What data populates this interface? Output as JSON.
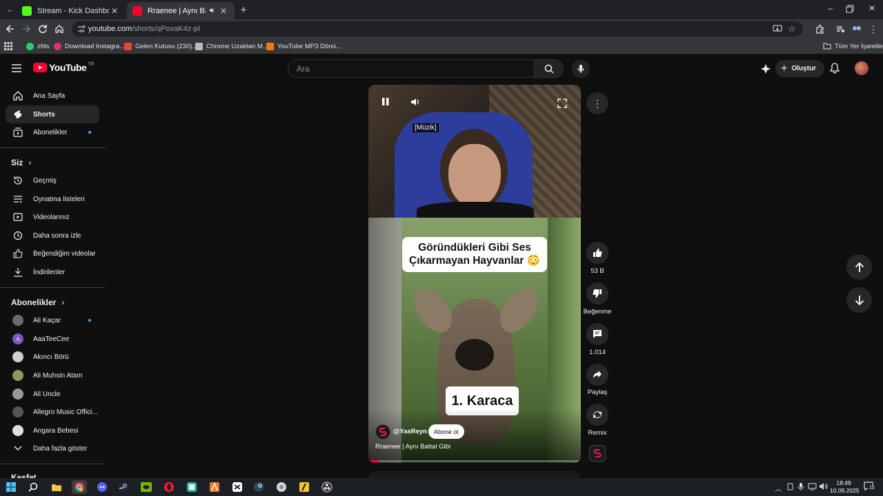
{
  "browser": {
    "tabs": [
      {
        "title": "Stream - Kick Dashboard",
        "favicon_color": "#53fc18"
      },
      {
        "title": "Rraenee | Aynı Battal Gibi -",
        "favicon_color": "#ff0033"
      }
    ],
    "url_host": "youtube.com",
    "url_path": "/shorts/qPoxaK4z-pI",
    "bookmarks": [
      "zfds",
      "Download Instagra...",
      "Gelen Kutusu (230)...",
      "Chrome Uzaktan M...",
      "YouTube MP3 Dönü..."
    ],
    "all_bookmarks": "Tüm Yer İşaretleri"
  },
  "youtube": {
    "logo_text": "YouTube",
    "region": "TR",
    "search_placeholder": "Ara",
    "create_label": "Oluştur",
    "accent": "#ff0033",
    "sidebar": {
      "main": [
        {
          "label": "Ana Sayfa",
          "icon": "home-icon"
        },
        {
          "label": "Shorts",
          "icon": "shorts-icon"
        },
        {
          "label": "Abonelikler",
          "icon": "subscriptions-icon"
        }
      ],
      "you_heading": "Siz",
      "you": [
        {
          "label": "Geçmiş",
          "icon": "history-icon"
        },
        {
          "label": "Oynatma listeleri",
          "icon": "playlists-icon"
        },
        {
          "label": "Videolarınız",
          "icon": "your-videos-icon"
        },
        {
          "label": "Daha sonra izle",
          "icon": "watch-later-icon"
        },
        {
          "label": "Beğendiğim videolar",
          "icon": "liked-icon"
        },
        {
          "label": "İndirilenler",
          "icon": "download-icon"
        }
      ],
      "subs_heading": "Abonelikler",
      "subs": [
        {
          "label": "Ali Kaçar",
          "color": "#6b6b6b"
        },
        {
          "label": "AaaTeeCee",
          "color": "#7e57c2"
        },
        {
          "label": "Akıncı Börü",
          "color": "#d0d0d0"
        },
        {
          "label": "Ali Muhsin Atam",
          "color": "#8a9a5b"
        },
        {
          "label": "Ali Uncle",
          "color": "#999999"
        },
        {
          "label": "Allegro Music Offici...",
          "color": "#555555"
        },
        {
          "label": "Angara Bebesi",
          "color": "#e0e0e0"
        }
      ],
      "show_more": "Daha fazla göster",
      "explore_heading": "Keşfet"
    },
    "short": {
      "caption_tag": "[Müzik]",
      "overlay_title_line1": "Göründükleri Gibi Ses",
      "overlay_title_line2": "Çıkarmayan Hayvanlar 😳",
      "overlay_label": "1. Karaca",
      "channel": "@YasReyn",
      "subscribe_label": "Abone ol",
      "video_title": "Rraenee | Aynı Battal Gibi",
      "progress": 0.05
    },
    "actions": {
      "likes": "53 B",
      "dislike_label": "Beğenme",
      "comments": "1.014",
      "share_label": "Paylaş",
      "remix_label": "Remix"
    }
  },
  "taskbar": {
    "time": "18:49",
    "date": "10.09.2025",
    "notifications": "10"
  }
}
